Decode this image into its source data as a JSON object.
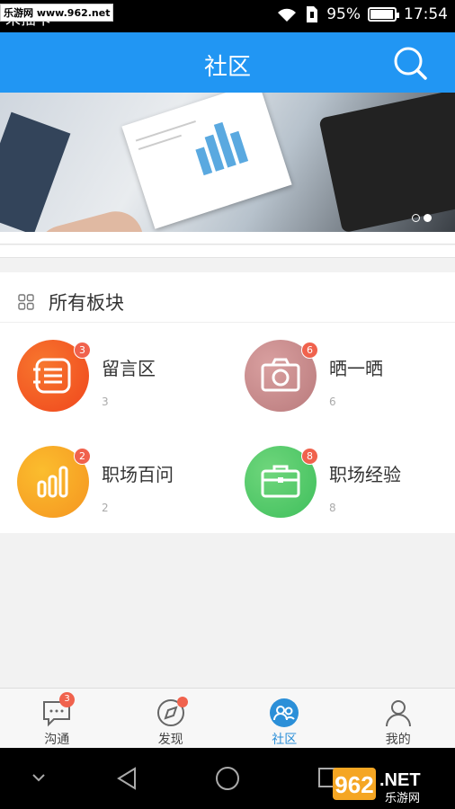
{
  "status_bar": {
    "carrier": "未插卡",
    "watermark": "乐游网 www.962.net",
    "battery": "95%",
    "battery_level": 0.95,
    "time": "17:54"
  },
  "header": {
    "title": "社区",
    "search_icon": "search-icon"
  },
  "banner": {
    "pages": 2,
    "active_page": 2
  },
  "section": {
    "title": "所有板块",
    "icon": "grid-icon",
    "boards": [
      {
        "name": "留言区",
        "count": "3",
        "badge": "3",
        "color": "#f25a1e",
        "icon": "message-list-icon"
      },
      {
        "name": "晒一晒",
        "count": "6",
        "badge": "6",
        "color": "#c8898a",
        "icon": "camera-icon"
      },
      {
        "name": "职场百问",
        "count": "2",
        "badge": "2",
        "color": "#f5a623",
        "icon": "bar-chart-icon"
      },
      {
        "name": "职场经验",
        "count": "8",
        "badge": "8",
        "color": "#4cc766",
        "icon": "briefcase-icon"
      }
    ]
  },
  "tabs": [
    {
      "label": "沟通",
      "icon": "chat-icon",
      "badge": "3"
    },
    {
      "label": "发现",
      "icon": "compass-icon",
      "dot": true
    },
    {
      "label": "社区",
      "icon": "community-icon",
      "active": true
    },
    {
      "label": "我的",
      "icon": "person-icon"
    }
  ],
  "brand": {
    "logo_text": "962.NET",
    "sub_text": "乐游网"
  },
  "colors": {
    "primary": "#2196f3",
    "badge": "#f0624d"
  }
}
